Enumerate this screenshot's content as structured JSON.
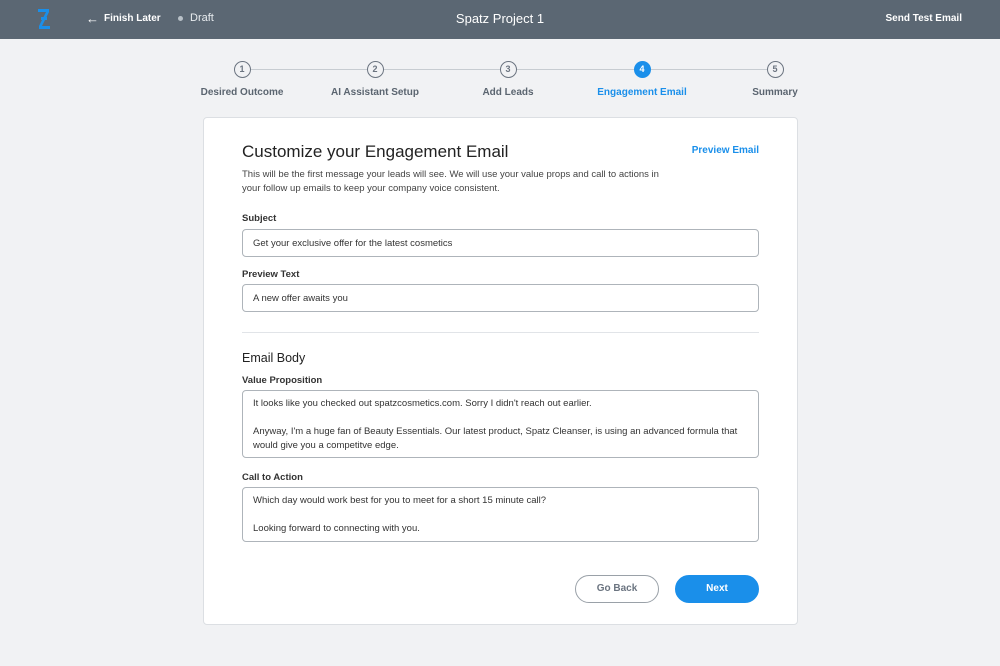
{
  "header": {
    "back_label": "Finish Later",
    "status": "Draft",
    "title": "Spatz Project 1",
    "send_test_label": "Send Test Email",
    "colors": {
      "bar": "#5b6773",
      "accent": "#1a8fea"
    }
  },
  "steps": [
    {
      "number": "1",
      "label": "Desired Outcome"
    },
    {
      "number": "2",
      "label": "AI Assistant Setup"
    },
    {
      "number": "3",
      "label": "Add Leads"
    },
    {
      "number": "4",
      "label": "Engagement Email"
    },
    {
      "number": "5",
      "label": "Summary"
    }
  ],
  "active_step": 4,
  "form": {
    "title": "Customize your Engagement Email",
    "preview_label": "Preview Email",
    "description": "This will be the first message your leads will see. We will use your value props and call to actions in your follow up emails to keep your company voice consistent.",
    "subject_label": "Subject",
    "subject_value": "Get your exclusive offer for the latest cosmetics",
    "preview_text_label": "Preview Text",
    "preview_text_value": "A new offer awaits you",
    "body_heading": "Email Body",
    "value_prop_label": "Value Proposition",
    "value_prop_p1": "It looks like you checked out spatzcosmetics.com. Sorry I didn't reach out earlier.",
    "value_prop_p2": "Anyway, I'm a huge fan of Beauty Essentials. Our latest product, Spatz Cleanser, is using an advanced formula that would give you a competitve edge.",
    "cta_label": "Call to Action",
    "cta_p1": "Which day would work best for you to meet for a short 15 minute call?",
    "cta_p2": "Looking forward to connecting with you."
  },
  "buttons": {
    "back": "Go Back",
    "next": "Next"
  }
}
